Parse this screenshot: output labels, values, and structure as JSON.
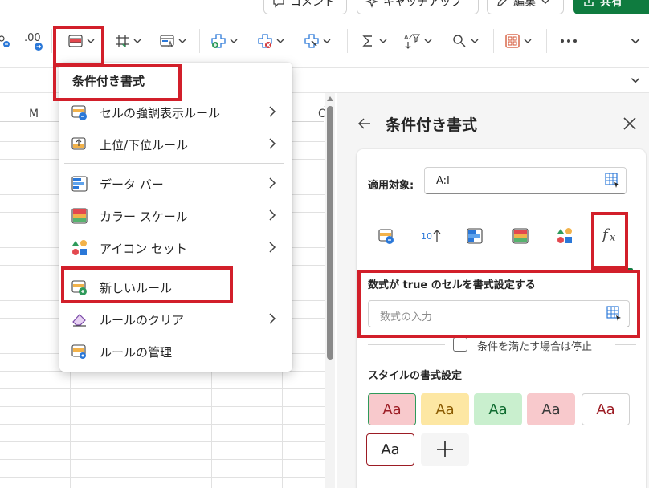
{
  "top_buttons": {
    "comment": "コメント",
    "catchup": "キャッチアップ",
    "edit": "編集",
    "share": "共有"
  },
  "toolbar": {
    "decimal_label": ".00"
  },
  "grid": {
    "column_headers": [
      "M",
      "C"
    ]
  },
  "menu": {
    "title": "条件付き書式",
    "items": [
      {
        "label": "セルの強調表示ルール",
        "icon": "highlight-rules-icon",
        "submenu": true
      },
      {
        "label": "上位/下位ルール",
        "icon": "top-bottom-rules-icon",
        "submenu": true
      },
      {
        "label": "データ バー",
        "icon": "data-bar-icon",
        "submenu": true
      },
      {
        "label": "カラー スケール",
        "icon": "color-scale-icon",
        "submenu": true
      },
      {
        "label": "アイコン セット",
        "icon": "icon-set-icon",
        "submenu": true
      },
      {
        "label": "新しいルール",
        "icon": "new-rule-icon",
        "submenu": false
      },
      {
        "label": "ルールのクリア",
        "icon": "eraser-icon",
        "submenu": true
      },
      {
        "label": "ルールの管理",
        "icon": "manage-rules-icon",
        "submenu": false
      }
    ]
  },
  "panel": {
    "title": "条件付き書式",
    "applies_to_label": "適用対象:",
    "applies_to_value": "A:I",
    "rule_types": [
      "highlight-cells",
      "top-10",
      "data-bar",
      "color-scale",
      "icon-set",
      "formula"
    ],
    "selected_rule_type": "formula",
    "top10_label": "10",
    "formula_label": "数式が true のセルを書式設定する",
    "formula_placeholder": "数式の入力",
    "stop_if_true_label": "条件を満たす場合は停止",
    "stop_if_true_checked": false,
    "style_label": "スタイルの書式設定",
    "styles": [
      {
        "text": "Aa",
        "bg": "#f8c9cc",
        "fg": "#9c1c24",
        "border": "#2e9a5a",
        "selected": true
      },
      {
        "text": "Aa",
        "bg": "#fde7a3",
        "fg": "#8a5a00",
        "border": "#fde7a3",
        "selected": false
      },
      {
        "text": "Aa",
        "bg": "#c9efce",
        "fg": "#0f6b30",
        "border": "#c9efce",
        "selected": false
      },
      {
        "text": "Aa",
        "bg": "#f8c9cc",
        "fg": "#3a3a3a",
        "border": "#f8c9cc",
        "selected": false
      },
      {
        "text": "Aa",
        "bg": "#ffffff",
        "fg": "#9c1c24",
        "border": "#d1d1d1",
        "selected": false
      },
      {
        "text": "Aa",
        "bg": "#ffffff",
        "fg": "#242424",
        "border": "#9c1c24",
        "selected": false
      }
    ]
  },
  "colors": {
    "highlight_red": "#d21f2a",
    "accent_green": "#0f7b3f"
  }
}
